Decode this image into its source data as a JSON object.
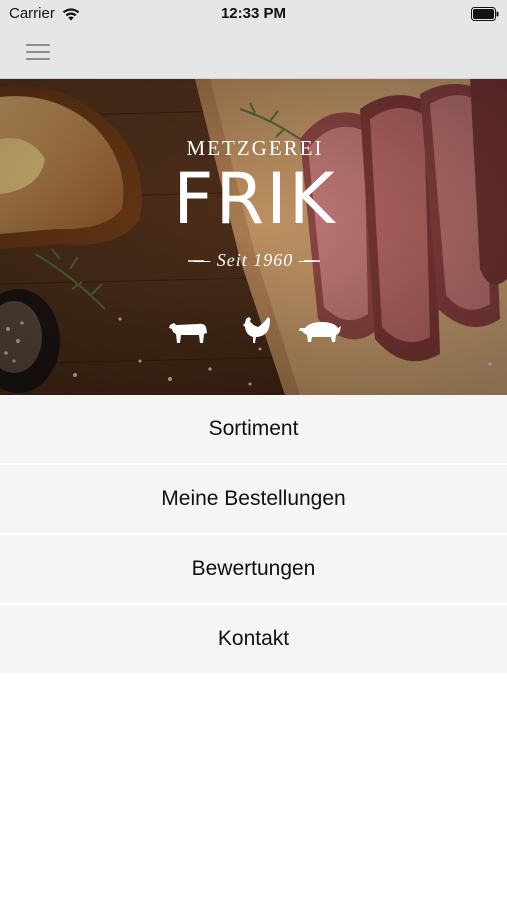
{
  "status_bar": {
    "carrier": "Carrier",
    "time": "12:33 PM"
  },
  "nav": {
    "menu_icon": "hamburger-menu-icon"
  },
  "hero": {
    "brand_line1": "METZGEREI",
    "brand_line2": "FRIK",
    "since": "— Seit 1960 —",
    "icons": [
      "cow-icon",
      "chicken-icon",
      "pig-icon"
    ]
  },
  "menu": {
    "items": [
      {
        "label": "Sortiment"
      },
      {
        "label": "Meine Bestellungen"
      },
      {
        "label": "Bewertungen"
      },
      {
        "label": "Kontakt"
      }
    ]
  },
  "colors": {
    "bar_background": "#e6e6e6",
    "menu_item_background": "#f5f5f5",
    "page_background": "#ffffff",
    "wood_dark": "#4a2c18",
    "meat_red": "#9b4a48"
  }
}
